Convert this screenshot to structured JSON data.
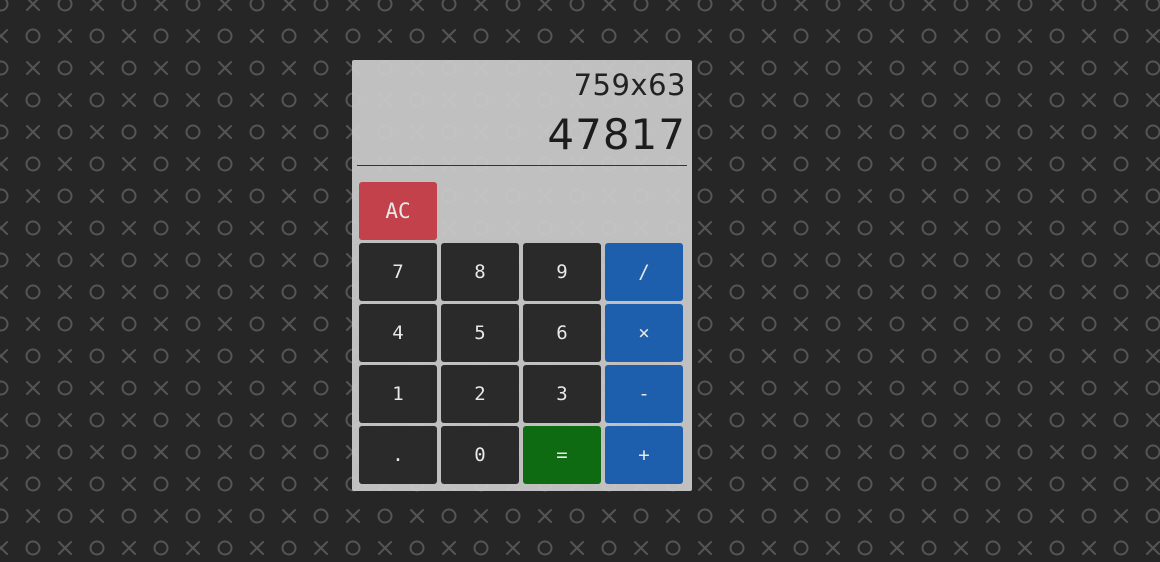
{
  "colors": {
    "background": "#262626",
    "pattern": "#555555",
    "panel": "#cdcdcd",
    "number_key": "#2a2a2a",
    "operator_key": "#1e5fad",
    "equals_key": "#0f6b12",
    "clear_key": "#c2414a"
  },
  "display": {
    "expression": "759x63",
    "result": "47817"
  },
  "keys": {
    "clear": "AC",
    "seven": "7",
    "eight": "8",
    "nine": "9",
    "divide": "/",
    "four": "4",
    "five": "5",
    "six": "6",
    "multiply": "×",
    "one": "1",
    "two": "2",
    "three": "3",
    "minus": "-",
    "dot": ".",
    "zero": "0",
    "equals": "=",
    "plus": "+"
  }
}
